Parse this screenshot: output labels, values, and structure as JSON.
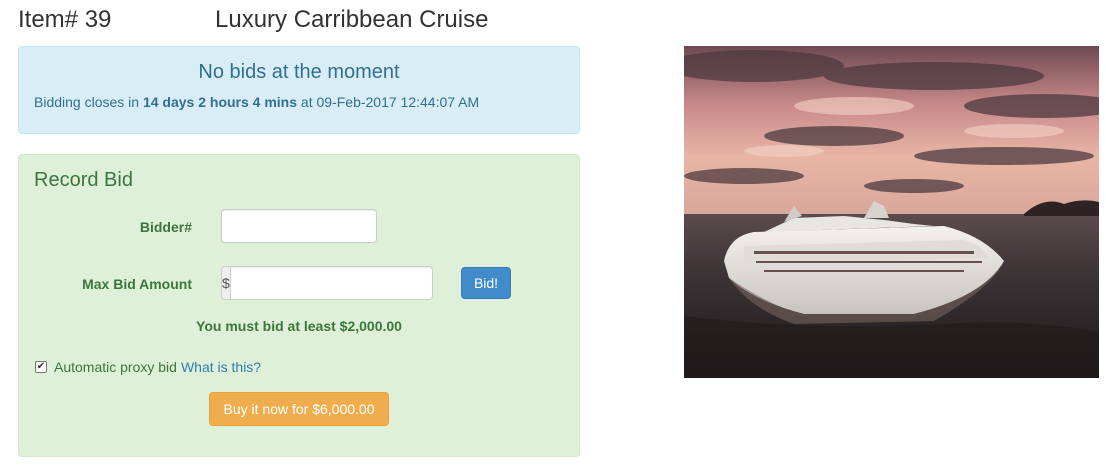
{
  "item": {
    "number_label": "Item# 39",
    "title": "Luxury Carribbean Cruise",
    "photo_icon": "cruise-ship-photo"
  },
  "status": {
    "heading": "No bids at the moment",
    "closes_prefix": "Bidding closes in",
    "time_remaining": "14 days 2 hours 4 mins",
    "at_word": "at",
    "close_datetime": "09-Feb-2017 12:44:07 AM"
  },
  "record_bid": {
    "title": "Record Bid",
    "bidder_label": "Bidder#",
    "bidder_value": "",
    "max_bid_label": "Max Bid Amount",
    "currency_symbol": "$",
    "max_bid_value": "",
    "bid_button": "Bid!",
    "min_bid_message": "You must bid at least $2,000.00",
    "proxy_checked": true,
    "proxy_label": "Automatic proxy bid",
    "proxy_help_link": "What is this?",
    "buy_now_button": "Buy it now for $6,000.00"
  },
  "colors": {
    "info_bg": "#d9edf7",
    "success_bg": "#dff0d8",
    "primary_button": "#428bca",
    "warning_button": "#f0ad4e",
    "link": "#337ab7"
  }
}
